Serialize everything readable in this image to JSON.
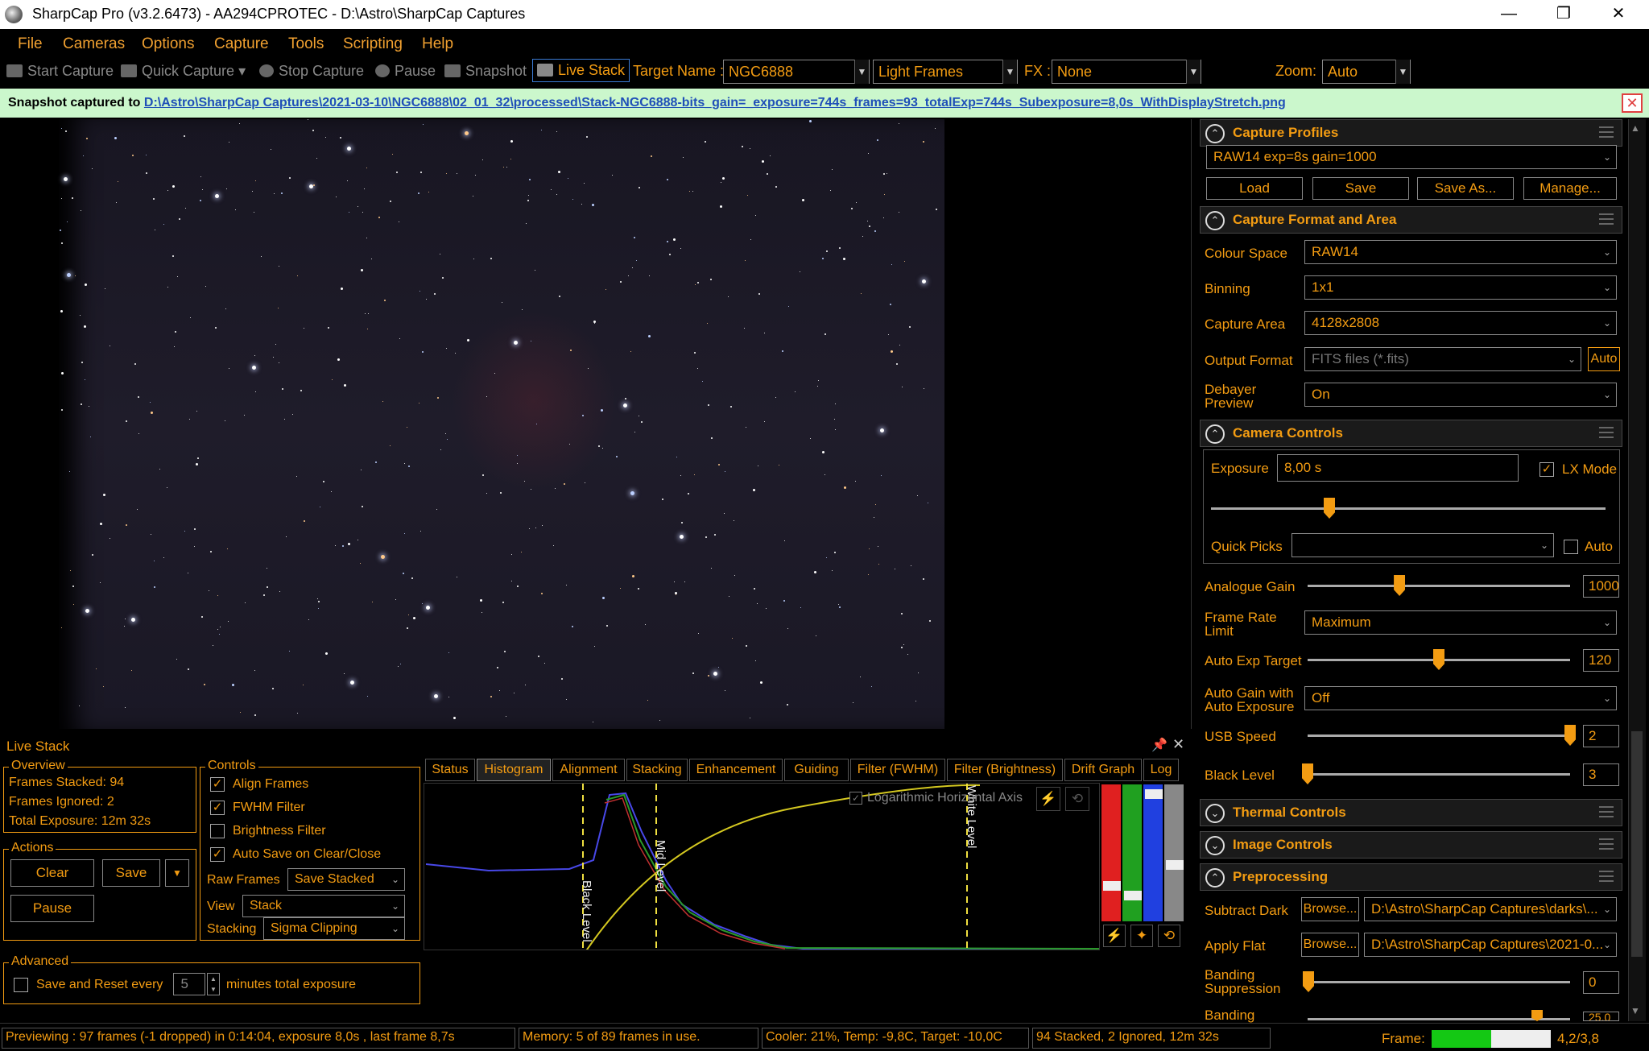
{
  "window": {
    "title": "SharpCap Pro (v3.2.6473) - AA294CPROTEC - D:\\Astro\\SharpCap Captures",
    "minimize": "—",
    "restore": "❐",
    "close": "✕"
  },
  "menu": [
    "File",
    "Cameras",
    "Options",
    "Capture",
    "Tools",
    "Scripting",
    "Help"
  ],
  "toolbar": {
    "start_capture": "Start Capture",
    "quick_capture": "Quick Capture",
    "stop_capture": "Stop Capture",
    "pause": "Pause",
    "snapshot": "Snapshot",
    "live_stack": "Live Stack",
    "target_name_label": "Target Name :",
    "target_name": "NGC6888",
    "frame_type": "Light Frames",
    "fx_label": "FX :",
    "fx_value": "None",
    "zoom_label": "Zoom:",
    "zoom_value": "Auto"
  },
  "notification": {
    "label": "Snapshot captured to",
    "path": "D:\\Astro\\SharpCap Captures\\2021-03-10\\NGC6888\\02_01_32\\processed\\Stack-NGC6888-bits_gain=_exposure=744s_frames=93_totalExp=744s_Subexposure=8,0s_WithDisplayStretch.png",
    "close": "✕"
  },
  "right_panel": {
    "capture_profiles": {
      "title": "Capture Profiles",
      "selected": "RAW14 exp=8s gain=1000",
      "load": "Load",
      "save": "Save",
      "save_as": "Save As...",
      "manage": "Manage..."
    },
    "capture_format": {
      "title": "Capture Format and Area",
      "colour_space_label": "Colour Space",
      "colour_space": "RAW14",
      "binning_label": "Binning",
      "binning": "1x1",
      "capture_area_label": "Capture Area",
      "capture_area": "4128x2808",
      "output_format_label": "Output Format",
      "output_format": "FITS files (*.fits)",
      "output_auto": "Auto",
      "debayer_label_1": "Debayer",
      "debayer_label_2": "Preview",
      "debayer": "On"
    },
    "camera_controls": {
      "title": "Camera Controls",
      "exposure_label": "Exposure",
      "exposure": "8,00 s",
      "lx_mode": "LX Mode",
      "lx_checked": "✓",
      "exposure_slider": 0.3,
      "quick_picks_label": "Quick Picks",
      "quick_picks_auto": "Auto",
      "analogue_gain_label": "Analogue Gain",
      "analogue_gain": "1000",
      "analogue_gain_slider": 0.35,
      "frame_rate_label_1": "Frame Rate",
      "frame_rate_label_2": "Limit",
      "frame_rate": "Maximum",
      "auto_exp_label": "Auto Exp Target",
      "auto_exp": "120",
      "auto_exp_slider": 0.5,
      "auto_gain_label_1": "Auto Gain with",
      "auto_gain_label_2": "Auto Exposure",
      "auto_gain": "Off",
      "usb_speed_label": "USB Speed",
      "usb_speed": "2",
      "usb_speed_slider": 1.0,
      "black_level_label": "Black Level",
      "black_level": "3",
      "black_level_slider": 0.0
    },
    "thermal_controls": {
      "title": "Thermal Controls"
    },
    "image_controls": {
      "title": "Image Controls"
    },
    "preprocessing": {
      "title": "Preprocessing",
      "subtract_dark_label": "Subtract Dark",
      "browse": "Browse...",
      "dark_path": "D:\\Astro\\SharpCap Captures\\darks\\...",
      "apply_flat_label": "Apply Flat",
      "flat_path": "D:\\Astro\\SharpCap Captures\\2021-0...",
      "banding_supp_label_1": "Banding",
      "banding_supp_label_2": "Suppression",
      "banding_supp": "0",
      "banding_label": "Banding",
      "banding_value": "25,0"
    }
  },
  "live_stack": {
    "title": "Live Stack",
    "overview": {
      "title": "Overview",
      "frames_stacked": "Frames Stacked: 94",
      "frames_ignored": "Frames Ignored:  2",
      "total_exposure": "Total Exposure:   12m 32s"
    },
    "actions": {
      "title": "Actions",
      "clear": "Clear",
      "save": "Save",
      "pause": "Pause"
    },
    "controls": {
      "title": "Controls",
      "align_frames": "Align Frames",
      "fwhm_filter": "FWHM Filter",
      "brightness_filter": "Brightness Filter",
      "auto_save": "Auto Save on Clear/Close",
      "checked": "✓",
      "raw_frames_label": "Raw Frames",
      "raw_frames": "Save Stacked",
      "view_label": "View",
      "view": "Stack",
      "stacking_label": "Stacking",
      "stacking": "Sigma Clipping"
    },
    "advanced": {
      "title": "Advanced",
      "save_reset": "Save and Reset every",
      "minutes": "5",
      "minutes_label": "minutes total exposure"
    },
    "tabs": [
      "Status",
      "Histogram",
      "Alignment",
      "Stacking",
      "Enhancement",
      "Guiding",
      "Filter (FWHM)",
      "Filter (Brightness)",
      "Drift Graph",
      "Log"
    ],
    "histogram": {
      "log_axis": "Logarithmic Horizontal Axis",
      "black_level": "Black Level",
      "mid_level": "Mid Level",
      "white_level": "White Level"
    }
  },
  "status_bar": {
    "preview": "Previewing : 97 frames (-1 dropped) in 0:14:04, exposure 8,0s , last frame 8,7s",
    "memory": "Memory: 5 of 89 frames in use.",
    "cooler": "Cooler: 21%, Temp: -9,8C, Target: -10,0C",
    "stacked": "94 Stacked, 2 Ignored, 12m 32s",
    "frame_label": "Frame:",
    "frame_progress": 0.5,
    "frame_value": "4,2/3,8"
  }
}
